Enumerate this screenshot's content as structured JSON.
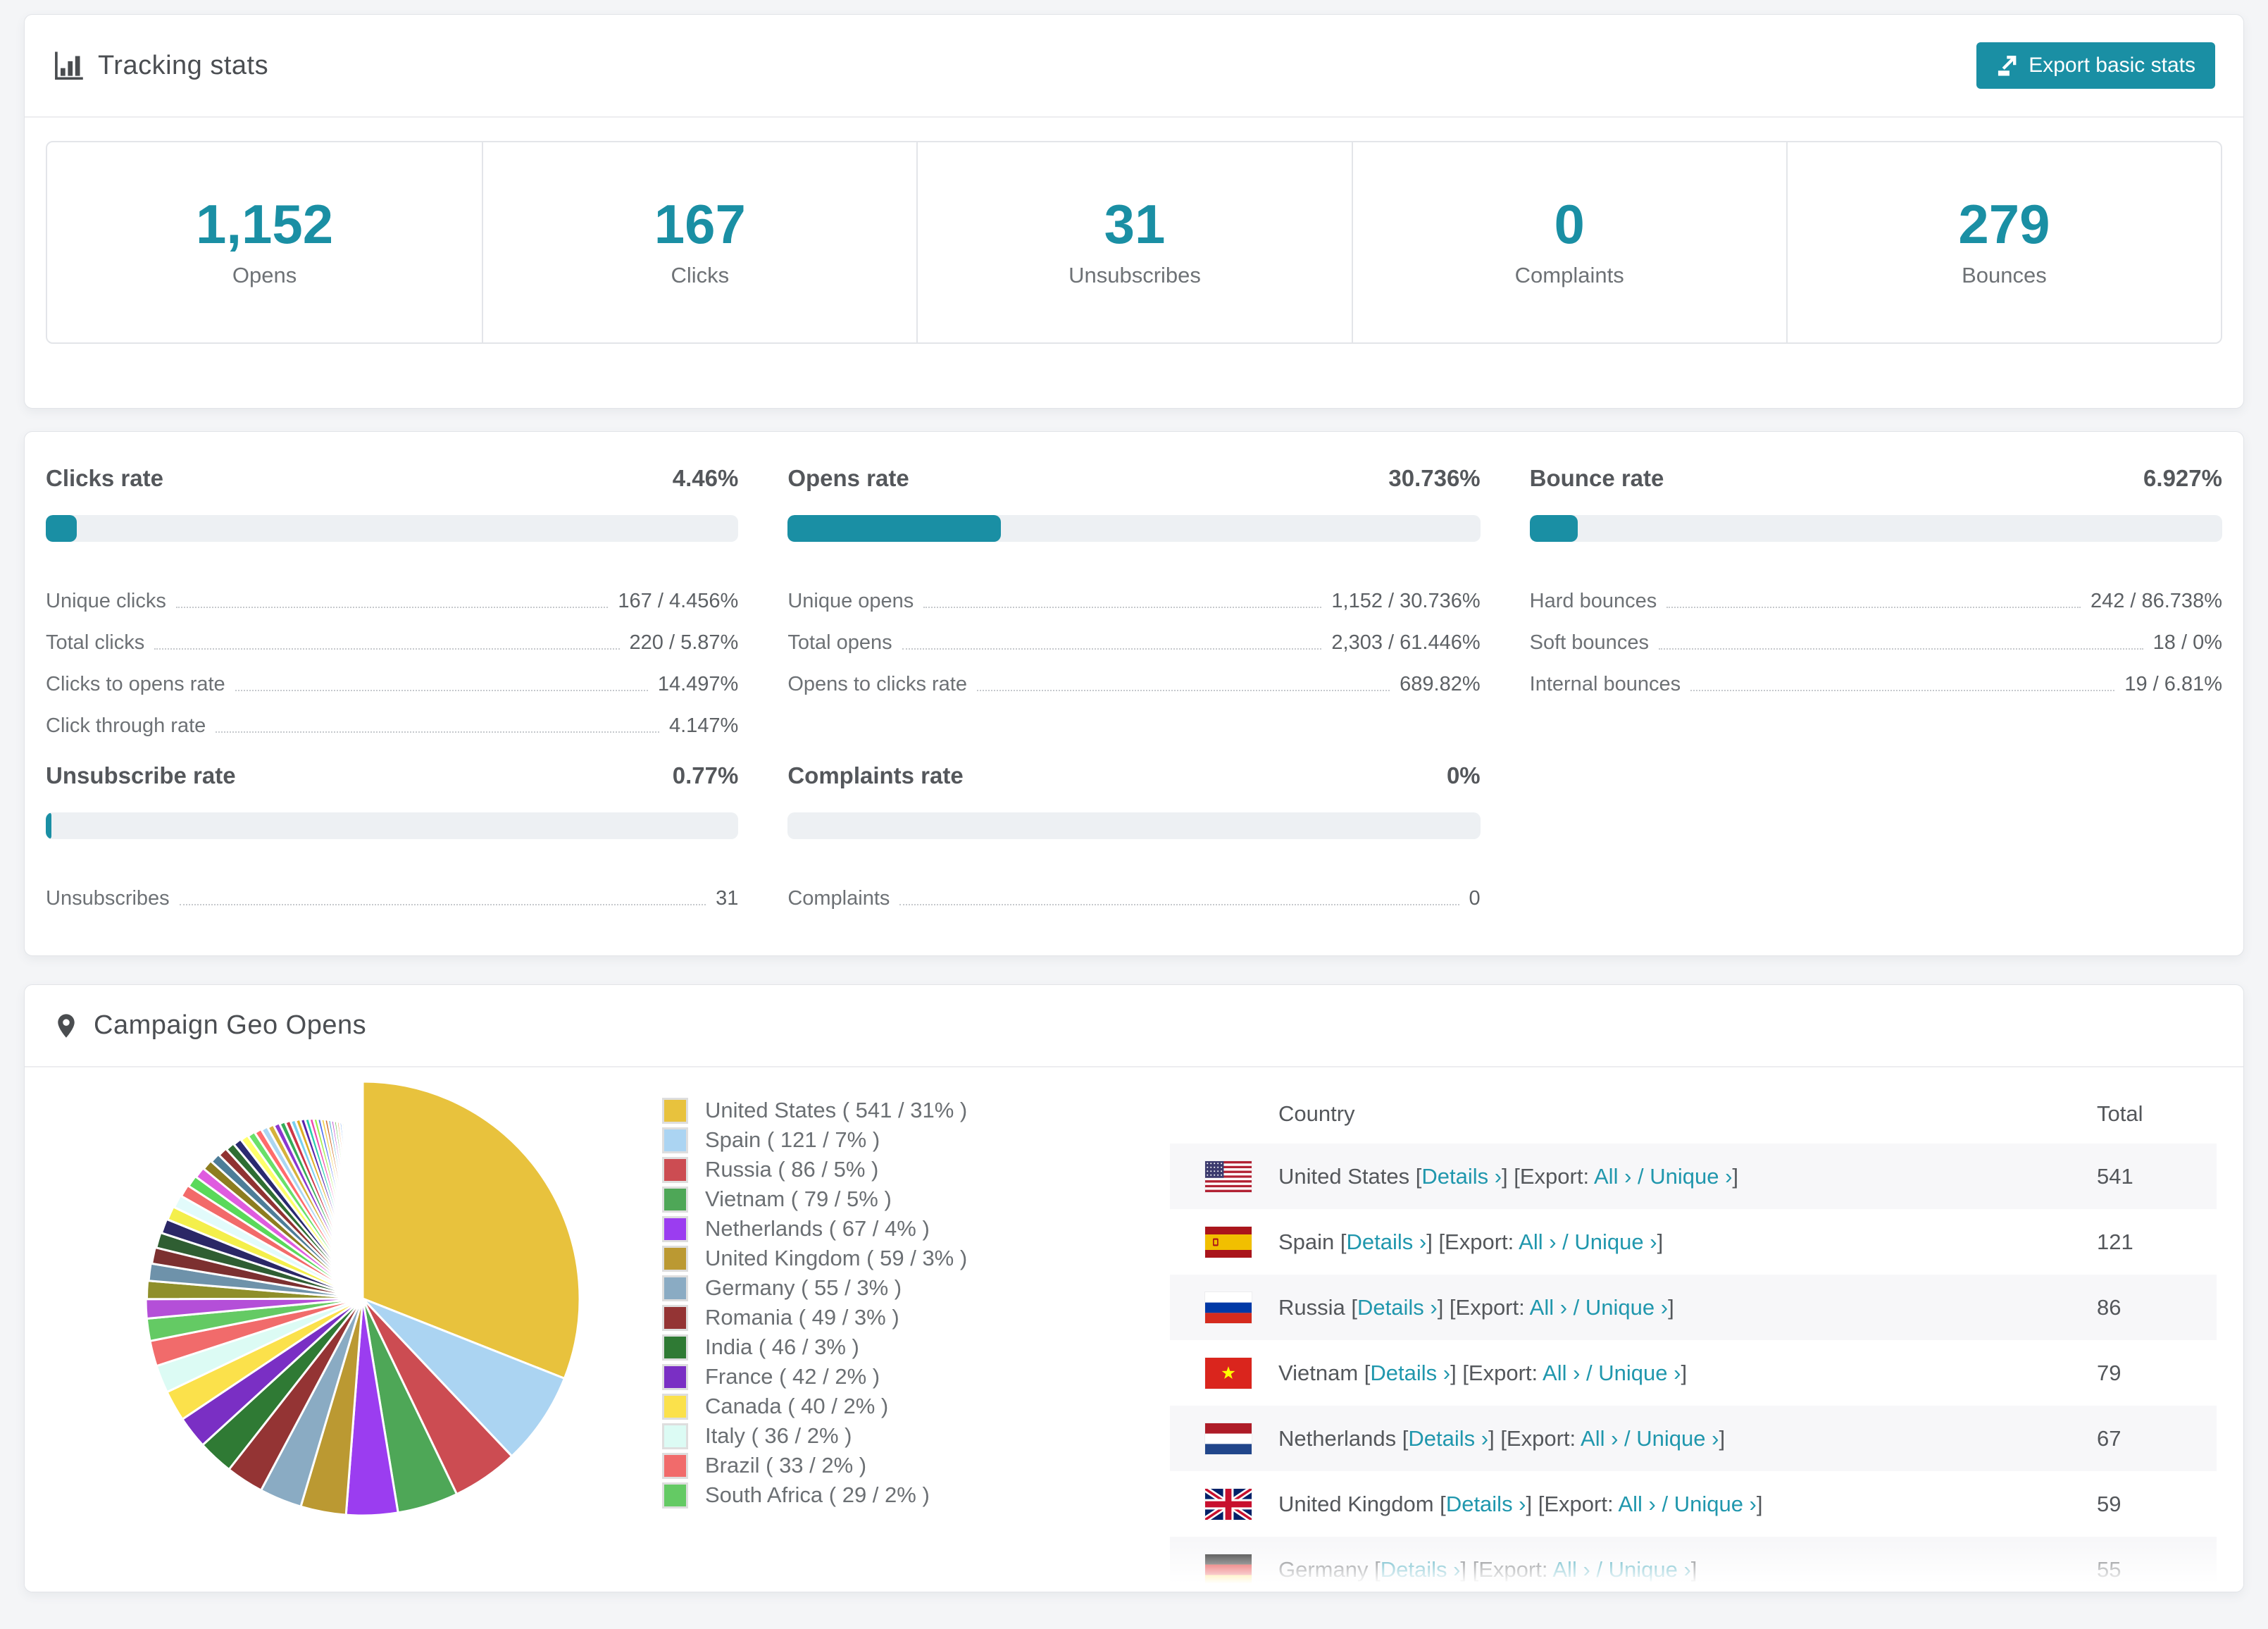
{
  "accent": "#1a8fa4",
  "page_background": "#f4f5f7",
  "header": {
    "title": "Tracking stats",
    "export_button": "Export basic stats"
  },
  "summary_cards": [
    {
      "value": "1,152",
      "label": "Opens"
    },
    {
      "value": "167",
      "label": "Clicks"
    },
    {
      "value": "31",
      "label": "Unsubscribes"
    },
    {
      "value": "0",
      "label": "Complaints"
    },
    {
      "value": "279",
      "label": "Bounces"
    }
  ],
  "rates": [
    {
      "title": "Clicks rate",
      "value": "4.46%",
      "percent": 4.46,
      "rows": [
        {
          "label": "Unique clicks",
          "value": "167 / 4.456%"
        },
        {
          "label": "Total clicks",
          "value": "220 / 5.87%"
        },
        {
          "label": "Clicks to opens rate",
          "value": "14.497%"
        },
        {
          "label": "Click through rate",
          "value": "4.147%"
        }
      ]
    },
    {
      "title": "Opens rate",
      "value": "30.736%",
      "percent": 30.736,
      "rows": [
        {
          "label": "Unique opens",
          "value": "1,152 / 30.736%"
        },
        {
          "label": "Total opens",
          "value": "2,303 / 61.446%"
        },
        {
          "label": "Opens to clicks rate",
          "value": "689.82%"
        }
      ]
    },
    {
      "title": "Bounce rate",
      "value": "6.927%",
      "percent": 6.927,
      "rows": [
        {
          "label": "Hard bounces",
          "value": "242 / 86.738%"
        },
        {
          "label": "Soft bounces",
          "value": "18 / 0%"
        },
        {
          "label": "Internal bounces",
          "value": "19 / 6.81%"
        }
      ]
    },
    {
      "title": "Unsubscribe rate",
      "value": "0.77%",
      "percent": 0.77,
      "rows": [
        {
          "label": "Unsubscribes",
          "value": "31"
        }
      ]
    },
    {
      "title": "Complaints rate",
      "value": "0%",
      "percent": 0,
      "rows": [
        {
          "label": "Complaints",
          "value": "0"
        }
      ]
    }
  ],
  "geo": {
    "title": "Campaign Geo Opens",
    "table": {
      "columns": [
        "Country",
        "Total"
      ],
      "labels": {
        "details": "Details",
        "export": "Export:",
        "all": "All",
        "unique": "Unique",
        "chevron": "›"
      },
      "rows": [
        {
          "country": "United States",
          "flag": "us",
          "total": "541"
        },
        {
          "country": "Spain",
          "flag": "es",
          "total": "121"
        },
        {
          "country": "Russia",
          "flag": "ru",
          "total": "86"
        },
        {
          "country": "Vietnam",
          "flag": "vn",
          "total": "79"
        },
        {
          "country": "Netherlands",
          "flag": "nl",
          "total": "67"
        },
        {
          "country": "United Kingdom",
          "flag": "gb",
          "total": "59"
        },
        {
          "country": "Germany",
          "flag": "de",
          "total": "55"
        }
      ]
    }
  },
  "chart_data": {
    "type": "pie",
    "title": "Campaign Geo Opens",
    "legend_position": "right",
    "series": [
      {
        "name": "United States",
        "value": 541,
        "pct": 31,
        "color": "#e8c23d"
      },
      {
        "name": "Spain",
        "value": 121,
        "pct": 7,
        "color": "#abd4f2"
      },
      {
        "name": "Russia",
        "value": 86,
        "pct": 5,
        "color": "#cc4c52"
      },
      {
        "name": "Vietnam",
        "value": 79,
        "pct": 5,
        "color": "#4ea757"
      },
      {
        "name": "Netherlands",
        "value": 67,
        "pct": 4,
        "color": "#9b3df0"
      },
      {
        "name": "United Kingdom",
        "value": 59,
        "pct": 3,
        "color": "#bb9932"
      },
      {
        "name": "Germany",
        "value": 55,
        "pct": 3,
        "color": "#8aabc3"
      },
      {
        "name": "Romania",
        "value": 49,
        "pct": 3,
        "color": "#943434"
      },
      {
        "name": "India",
        "value": 46,
        "pct": 3,
        "color": "#2f7a34"
      },
      {
        "name": "France",
        "value": 42,
        "pct": 2,
        "color": "#7a2fc4"
      },
      {
        "name": "Canada",
        "value": 40,
        "pct": 2,
        "color": "#fbe14b"
      },
      {
        "name": "Italy",
        "value": 36,
        "pct": 2,
        "color": "#dcfbf4"
      },
      {
        "name": "Brazil",
        "value": 33,
        "pct": 2,
        "color": "#f16b6b"
      },
      {
        "name": "South Africa",
        "value": 29,
        "pct": 2,
        "color": "#64ca64"
      }
    ],
    "others_total": 462,
    "others_palette": [
      "#b44fd8",
      "#8f8f2a",
      "#6e92aa",
      "#7c3030",
      "#2f5e32",
      "#2b2766",
      "#f4ef4b",
      "#e2fbfb",
      "#f26a6a",
      "#5ad95a",
      "#df5cdf",
      "#8d7d20",
      "#4d7d98",
      "#903232",
      "#2f6e32",
      "#2a2a70",
      "#ffff6b",
      "#69e069",
      "#ff6b6b",
      "#abd6f2",
      "#d6b23a",
      "#8c36ce",
      "#36ac58",
      "#ce3648",
      "#7ad0f0",
      "#dfae26",
      "#5826ac",
      "#26ceac",
      "#f048ac",
      "#9df048",
      "#4869f0",
      "#f0ce48",
      "#ce6926",
      "#48acce",
      "#bd48ce",
      "#69bd48",
      "#f08d48",
      "#4889f0",
      "#cef048",
      "#f04869"
    ]
  }
}
